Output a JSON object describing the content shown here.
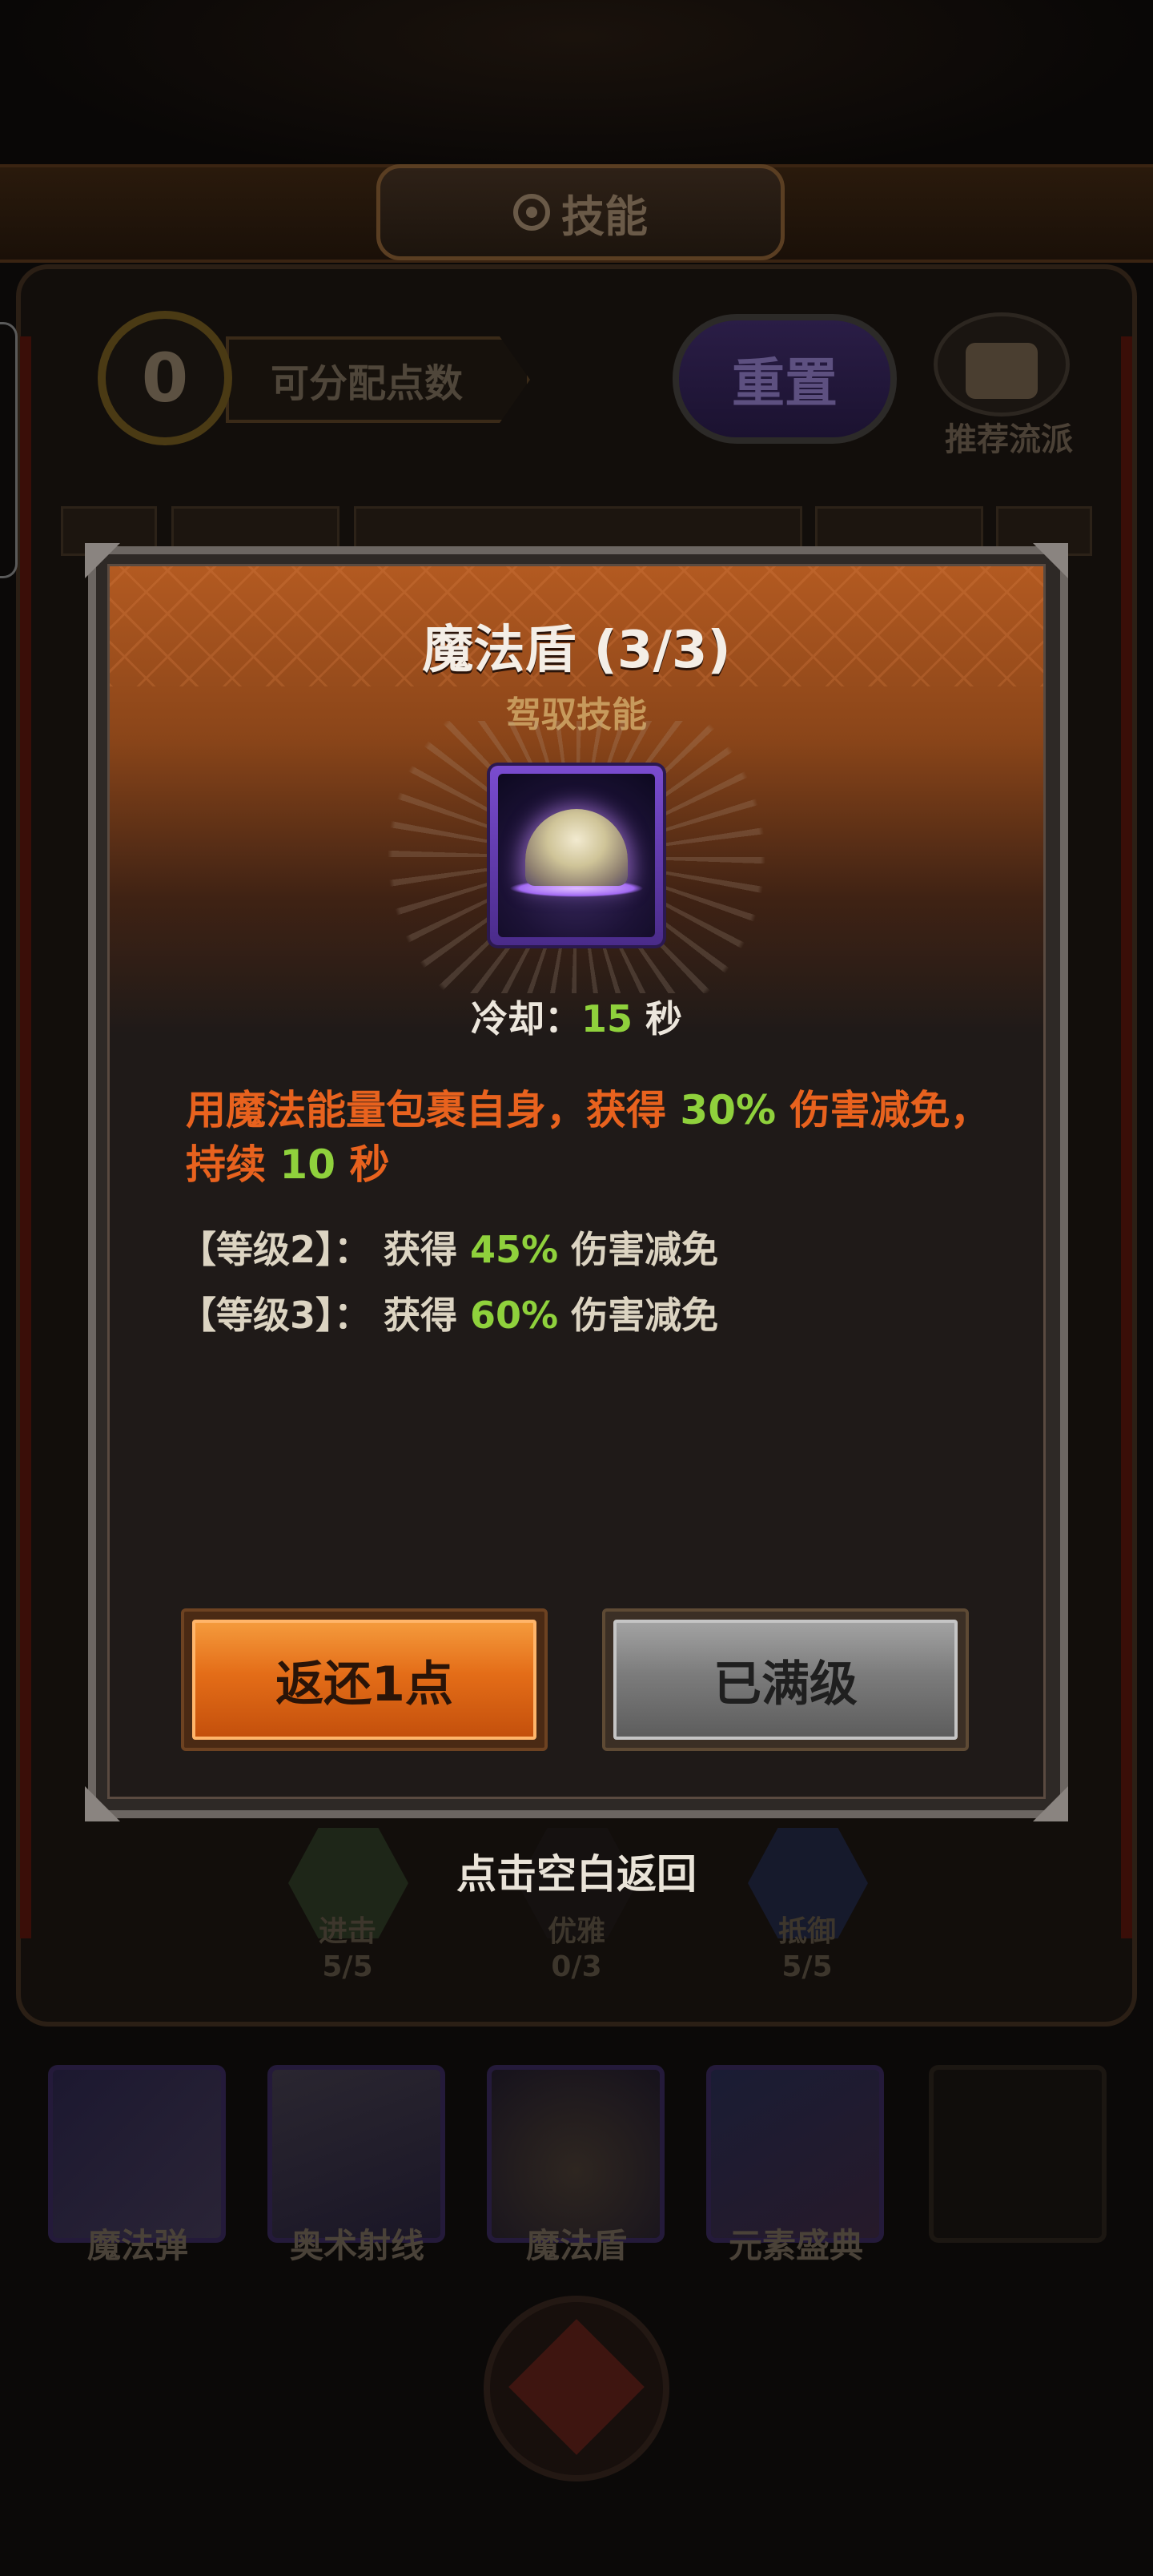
{
  "background": {
    "title": "技能",
    "available_points": "0",
    "available_points_label": "可分配点数",
    "reset_label": "重置",
    "recommend_label": "推荐流派",
    "branches": [
      {
        "name": "进击",
        "progress": "5/5"
      },
      {
        "name": "优雅",
        "progress": "0/3"
      },
      {
        "name": "抵御",
        "progress": "5/5"
      }
    ],
    "skills": [
      "魔法弹",
      "奥术射线",
      "魔法盾",
      "元素盛典"
    ]
  },
  "modal": {
    "title": "魔法盾 (3/3)",
    "subtitle": "驾驭技能",
    "icon": "magic-shield-dome-icon",
    "cooldown_label": "冷却：",
    "cooldown_value": "15",
    "cooldown_unit": "秒",
    "description": {
      "part1": "用魔法能量包裹自身，获得",
      "value1": "30%",
      "part2": "伤害减免，持续",
      "value2": "10",
      "part3": "秒"
    },
    "levels": [
      {
        "label": "【等级2】：",
        "prefix": "获得",
        "value": "45%",
        "suffix": "伤害减免"
      },
      {
        "label": "【等级3】：",
        "prefix": "获得",
        "value": "60%",
        "suffix": "伤害减免"
      }
    ],
    "refund_button": "返还1点",
    "maxed_button": "已满级"
  },
  "hint": "点击空白返回",
  "colors": {
    "accent_orange": "#e8621e",
    "value_green": "#8fd13c",
    "title_text": "#f4eee6"
  }
}
